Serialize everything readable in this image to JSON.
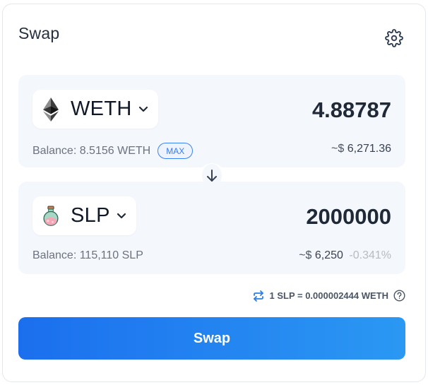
{
  "header": {
    "title": "Swap",
    "settings_icon": "gear-icon"
  },
  "from": {
    "token": "WETH",
    "token_icon": "ethereum-icon",
    "amount": "4.88787",
    "balance": "Balance: 8.5156 WETH",
    "max_label": "MAX",
    "usd_prefix": "~$",
    "usd_value": "6,271.36"
  },
  "switch": {
    "icon": "arrow-down-icon"
  },
  "to": {
    "token": "SLP",
    "token_icon": "slp-potion-icon",
    "amount": "2000000",
    "balance": "Balance: 115,110 SLP",
    "usd_prefix": "~$",
    "usd_value": "6,250",
    "price_impact": "-0.341%"
  },
  "rate": {
    "text": "1 SLP = 0.000002444 WETH",
    "swap_icon": "swap-arrows-icon",
    "help_icon": "help-icon"
  },
  "action": {
    "swap_label": "Swap"
  },
  "colors": {
    "accent": "#1b6fee",
    "accent_end": "#2b98f3",
    "panel_bg": "#f4f7fb",
    "muted": "#b6bcc5"
  }
}
